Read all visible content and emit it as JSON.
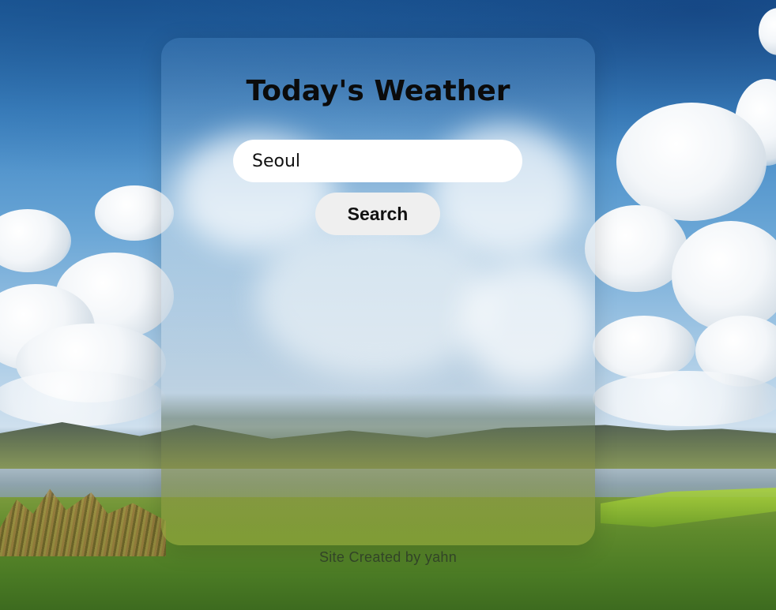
{
  "header": {
    "title": "Today's Weather"
  },
  "search": {
    "value": "Seoul",
    "button_label": "Search"
  },
  "footer": {
    "text": "Site Created by yahn"
  },
  "colors": {
    "card_bg": "#d7e4ee",
    "input_bg": "#ffffff",
    "button_bg": "#efefef",
    "title_text": "#0b0b0b"
  }
}
